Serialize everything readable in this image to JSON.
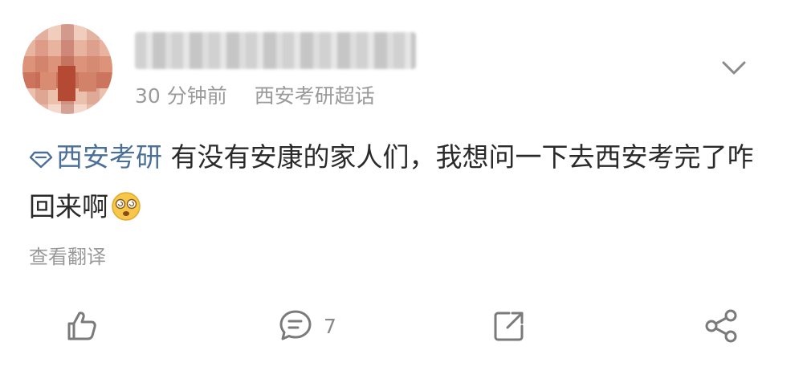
{
  "post": {
    "meta": {
      "time": "30 分钟前",
      "source": "西安考研超话"
    },
    "topic": "西安考研",
    "text": " 有没有安康的家人们，我想问一下去西安考完了咋回来啊",
    "translate_label": "查看翻译"
  },
  "actions": {
    "comment_count": "7"
  },
  "icons": [
    "chevron-down-icon",
    "topic-diamond-icon",
    "dizzy-emoji-icon",
    "like-icon",
    "comment-icon",
    "repost-icon",
    "share-icon"
  ],
  "colors": {
    "topic": "#4a6f99",
    "meta_gray": "#9a9a9a",
    "text": "#2a2a2a"
  }
}
